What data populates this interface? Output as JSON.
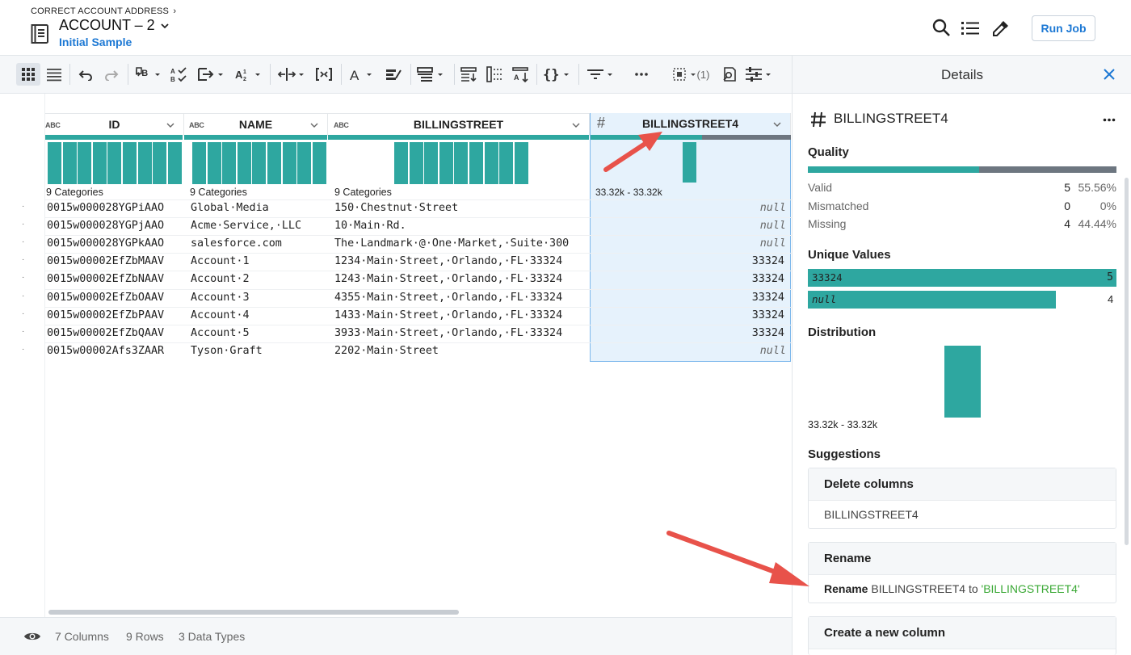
{
  "header": {
    "breadcrumb": "CORRECT ACCOUNT ADDRESS",
    "title": "ACCOUNT – 2",
    "subtitle": "Initial Sample",
    "run_job": "Run Job"
  },
  "toolbar": {
    "filter_count": "(1)"
  },
  "grid": {
    "columns": [
      {
        "name": "ID",
        "type": "ABC",
        "summary": "9 Categories"
      },
      {
        "name": "NAME",
        "type": "ABC",
        "summary": "9 Categories"
      },
      {
        "name": "BILLINGSTREET",
        "type": "ABC",
        "summary": "9 Categories"
      },
      {
        "name": "BILLINGSTREET4",
        "type": "#",
        "summary": "33.32k - 33.32k"
      }
    ],
    "rows": [
      [
        "0015w000028YGPiAAO",
        "Global·Media",
        "150·Chestnut·Street",
        "null"
      ],
      [
        "0015w000028YGPjAAO",
        "Acme·Service,·LLC",
        "10·Main·Rd.",
        "null"
      ],
      [
        "0015w000028YGPkAAO",
        "salesforce.com",
        "The·Landmark·@·One·Market,·Suite·300",
        "null"
      ],
      [
        "0015w00002EfZbMAAV",
        "Account·1",
        "1234·Main·Street,·Orlando,·FL·33324",
        "33324"
      ],
      [
        "0015w00002EfZbNAAV",
        "Account·2",
        "1243·Main·Street,·Orlando,·FL·33324",
        "33324"
      ],
      [
        "0015w00002EfZbOAAV",
        "Account·3",
        "4355·Main·Street,·Orlando,·FL·33324",
        "33324"
      ],
      [
        "0015w00002EfZbPAAV",
        "Account·4",
        "1433·Main·Street,·Orlando,·FL·33324",
        "33324"
      ],
      [
        "0015w00002EfZbQAAV",
        "Account·5",
        "3933·Main·Street,·Orlando,·FL·33324",
        "33324"
      ],
      [
        "0015w00002Afs3ZAAR",
        "Tyson·Graft",
        "2202·Main·Street",
        "null"
      ]
    ]
  },
  "footer": {
    "columns": "7 Columns",
    "rows": "9 Rows",
    "types": "3 Data Types"
  },
  "details": {
    "title": "Details",
    "column": "BILLINGSTREET4",
    "quality_label": "Quality",
    "quality": [
      {
        "label": "Valid",
        "count": "5",
        "pct": "55.56%"
      },
      {
        "label": "Mismatched",
        "count": "0",
        "pct": "0%"
      },
      {
        "label": "Missing",
        "count": "4",
        "pct": "44.44%"
      }
    ],
    "quality_valid_fraction": 0.5556,
    "unique_label": "Unique Values",
    "unique": [
      {
        "value": "33324",
        "count": "5"
      },
      {
        "value": "null",
        "count": "4"
      }
    ],
    "distribution_label": "Distribution",
    "distribution_range": "33.32k - 33.32k",
    "suggestions_label": "Suggestions",
    "suggestions": [
      {
        "title": "Delete columns",
        "body": "BILLINGSTREET4"
      },
      {
        "title": "Rename",
        "body_prefix": "Rename",
        "body_mid": "BILLINGSTREET4 to",
        "body_value": "'BILLINGSTREET4'"
      },
      {
        "title": "Create a new column"
      }
    ]
  },
  "colors": {
    "teal": "#2ea7a0",
    "gray": "#6d7680",
    "link": "#1c78d4",
    "suggest_green": "#3aa835",
    "arrow": "#e8524a"
  }
}
